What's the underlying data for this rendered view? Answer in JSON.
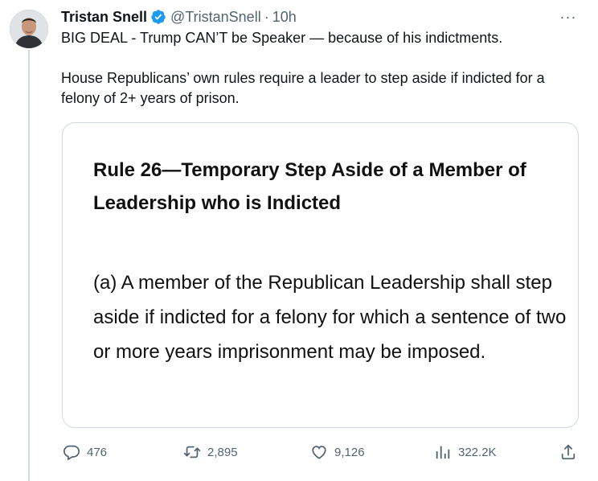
{
  "author": {
    "display_name": "Tristan Snell",
    "handle": "@TristanSnell",
    "separator": "·",
    "time": "10h"
  },
  "tweet": {
    "paragraph1": "BIG DEAL - Trump CAN’T be Speaker — because of his indictments.",
    "paragraph2": "House Republicans’ own rules require a leader to step aside if indicted for a felony of 2+ years of prison."
  },
  "media": {
    "rule_title": "Rule 26—Temporary Step Aside of a Member of Leadership who is Indicted",
    "rule_body": "(a) A member of the Republican Leadership shall step aside if indicted for a felony for which a sentence of two or more years imprisonment may be imposed."
  },
  "actions": {
    "replies": "476",
    "retweets": "2,895",
    "likes": "9,126",
    "views": "322.2K"
  },
  "more_label": "···",
  "colors": {
    "verified": "#1d9bf0",
    "muted": "#536471",
    "border": "#cfd9de"
  }
}
